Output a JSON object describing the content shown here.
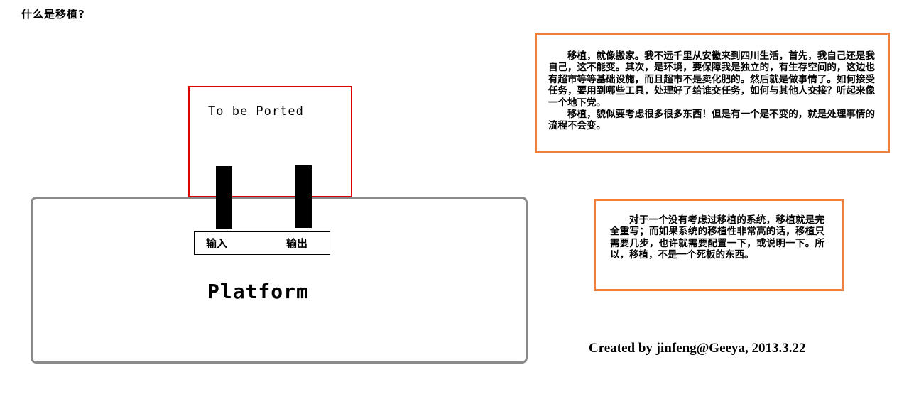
{
  "page": {
    "title": "什么是移植?"
  },
  "diagram": {
    "ported_label": "To be Ported",
    "input_label": "输入",
    "output_label": "输出",
    "platform_label": "Platform",
    "colors": {
      "ported_border": "#e00000",
      "platform_border": "#8a8a8a",
      "note_border": "#f07f3c",
      "pin": "#000000"
    }
  },
  "notes": {
    "note1": {
      "para1": "移植，就像搬家。我不远千里从安徽来到四川生活，首先，我自己还是我自己，这不能变。其次，是环境，要保障我是独立的，有生存空间的，这边也有超市等等基础设施，而且超市不是卖化肥的。然后就是做事情了。如何接受任务，要用到哪些工具，处理好了给谁交任务，如何与其他人交接？听起来像一个地下党。",
      "para2": "移植，貌似要考虑很多很多东西！但是有一个是不变的，就是处理事情的流程不会变。"
    },
    "note2": {
      "para1": "对于一个没有考虑过移植的系统，移植就是完全重写；而如果系统的移植性非常高的话，移植只需要几步，也许就需要配置一下，或说明一下。所以，移植，不是一个死板的东西。"
    }
  },
  "footer": {
    "credit": "Created by jinfeng@Geeya, 2013.3.22"
  }
}
